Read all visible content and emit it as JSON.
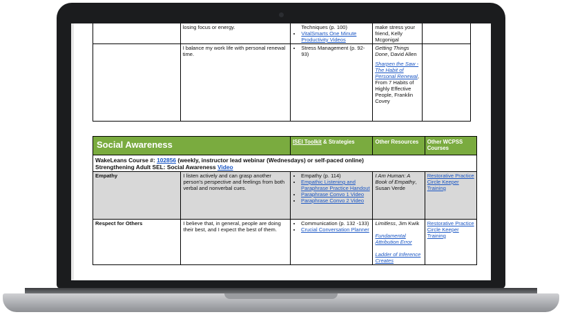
{
  "row_top": {
    "statement": "losing focus or energy.",
    "strategies_text": "Techniques (p. 100)",
    "strategies_link": "VitalSmarts One Minute Productivity Videos",
    "resources": "make stress your friend, Kelly Mcgonigal"
  },
  "row_balance": {
    "statement": "I balance my work life with personal renewal time.",
    "strategy": "Stress Management (p. 92-93)",
    "book1_title": "Getting Things Done",
    "book1_author": ", David Allen",
    "link": "Sharpen the Saw - The Habit of Personal Renewal",
    "after_link": ", From 7 Habits of Highly Effective People, Franklin Covey"
  },
  "section": {
    "title": "Social Awareness",
    "col_isei_link": "ISEI Toolkit",
    "col_isei_rest": " & Strategies",
    "col_other": "Other Resources",
    "col_wcpss": "Other WCPSS Courses"
  },
  "course": {
    "prefix": "WakeLeans Course #: ",
    "number": "102856",
    "suffix": " (weekly, instructor lead webinar (Wednesdays) or self-paced online)",
    "line2": "Strengthening Adult SEL: Social Awareness ",
    "video": "Video"
  },
  "empathy": {
    "name": "Empathy",
    "statement": "I listen actively and can grasp another person's perspective and feelings from both verbal and nonverbal cues.",
    "strategies": [
      "Empathy (p. 114)",
      "Empathic Listening and Paraphrase Practice Handout",
      "Paraphrase Convo 1 Video",
      "Paraphrase Convo 2 Video"
    ],
    "resource_title": "I Am Human: A Book of Empathy",
    "resource_author": ", Susan Verde",
    "course_link": "Restorative Practice Circle Keeper Training"
  },
  "respect": {
    "name": "Respect for Others",
    "statement": "I believe that, in general, people are doing their best, and I expect the best of them.",
    "strategies": [
      "Communication (p. 132 -133)",
      "Crucial Conversation Planner"
    ],
    "resource1_title": "Limitless",
    "resource1_author": ", Jim Kwik",
    "resource2": "Fundamental Attribution Error",
    "resource3": "Ladder of Inference Creates",
    "course_link": "Restorative Practice Circle Keeper Training"
  }
}
